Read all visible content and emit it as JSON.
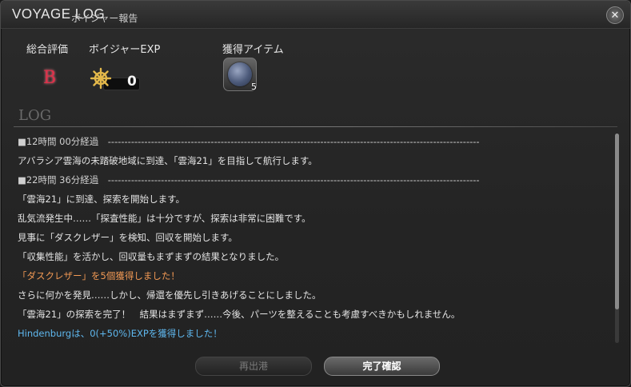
{
  "window": {
    "title": "VOYAGE LOG",
    "subtitle": "ボイジャー報告"
  },
  "summary": {
    "rating_label": "総合評価",
    "rating_value": "B",
    "exp_label": "ボイジャーEXP",
    "exp_value": "0",
    "items_label": "獲得アイテム",
    "item_count": "5"
  },
  "log": {
    "title": "LOG",
    "lines": [
      {
        "text": "■12時間 00分経過　----------------------------------------------------------------------------------------------------------------",
        "style": "header"
      },
      {
        "text": "アバラシア雲海の未踏破地域に到達、「雲海21」を目指して航行します。",
        "style": "normal"
      },
      {
        "text": "■22時間 36分経過　----------------------------------------------------------------------------------------------------------------",
        "style": "header"
      },
      {
        "text": "「雲海21」に到達、探索を開始します。",
        "style": "normal"
      },
      {
        "text": "乱気流発生中……「探査性能」は十分ですが、探索は非常に困難です。",
        "style": "normal"
      },
      {
        "text": "見事に「ダスクレザー」を検知、回収を開始します。",
        "style": "normal"
      },
      {
        "text": "「収集性能」を活かし、回収量もまずまずの結果となりました。",
        "style": "normal"
      },
      {
        "text": "「ダスクレザー」を5個獲得しました！",
        "style": "orange"
      },
      {
        "text": "さらに何かを発見……しかし、帰還を優先し引きあげることにしました。",
        "style": "normal"
      },
      {
        "text": "「雲海21」の探索を完了！　結果はまずまず……今後、パーツを整えることも考慮すべきかもしれません。",
        "style": "normal"
      },
      {
        "text": "Hindenburgは、0(+50%)EXPを獲得しました！",
        "style": "blue"
      }
    ]
  },
  "buttons": {
    "redeploy": "再出港",
    "finalize": "完了確認"
  },
  "icons": {
    "close": "close-icon",
    "wheel": "ship-wheel-icon",
    "item": "dusk-leather-icon"
  },
  "colors": {
    "grade": "#e0304a",
    "highlight_orange": "#f39a55",
    "highlight_blue": "#5fb8ef"
  }
}
